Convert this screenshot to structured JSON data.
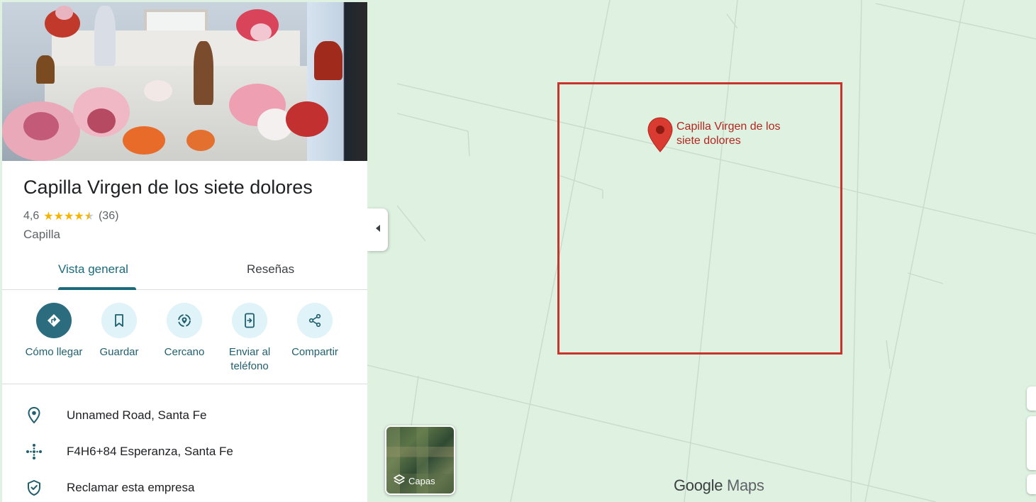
{
  "place": {
    "name": "Capilla Virgen de los siete dolores",
    "rating": "4,6",
    "rating_value": 4.6,
    "review_count": "(36)",
    "category": "Capilla"
  },
  "tabs": [
    {
      "label": "Vista general",
      "active": true
    },
    {
      "label": "Reseñas",
      "active": false
    }
  ],
  "actions": [
    {
      "label": "Cómo llegar",
      "icon": "directions-icon"
    },
    {
      "label": "Guardar",
      "icon": "bookmark-icon"
    },
    {
      "label": "Cercano",
      "icon": "nearby-icon"
    },
    {
      "label": "Enviar al teléfono",
      "icon": "send-to-phone-icon"
    },
    {
      "label": "Compartir",
      "icon": "share-icon"
    }
  ],
  "info_rows": [
    {
      "text": "Unnamed Road, Santa Fe",
      "icon": "location-pin-icon"
    },
    {
      "text": "F4H6+84 Esperanza, Santa Fe",
      "icon": "plus-code-icon"
    },
    {
      "text": "Reclamar esta empresa",
      "icon": "shield-check-icon"
    }
  ],
  "map": {
    "marker_label": "Capilla Virgen de los siete dolores",
    "layers_label": "Capas",
    "logo_google": "Google",
    "logo_maps": "Maps",
    "highlight_color": "#c8332c",
    "marker_color": "#d93b30",
    "map_background": "#dff2e1"
  },
  "colors": {
    "accent": "#1a6a7a",
    "primary_action": "#2b6c7e",
    "action_bg": "#dff3f8",
    "star": "#f4b400"
  }
}
